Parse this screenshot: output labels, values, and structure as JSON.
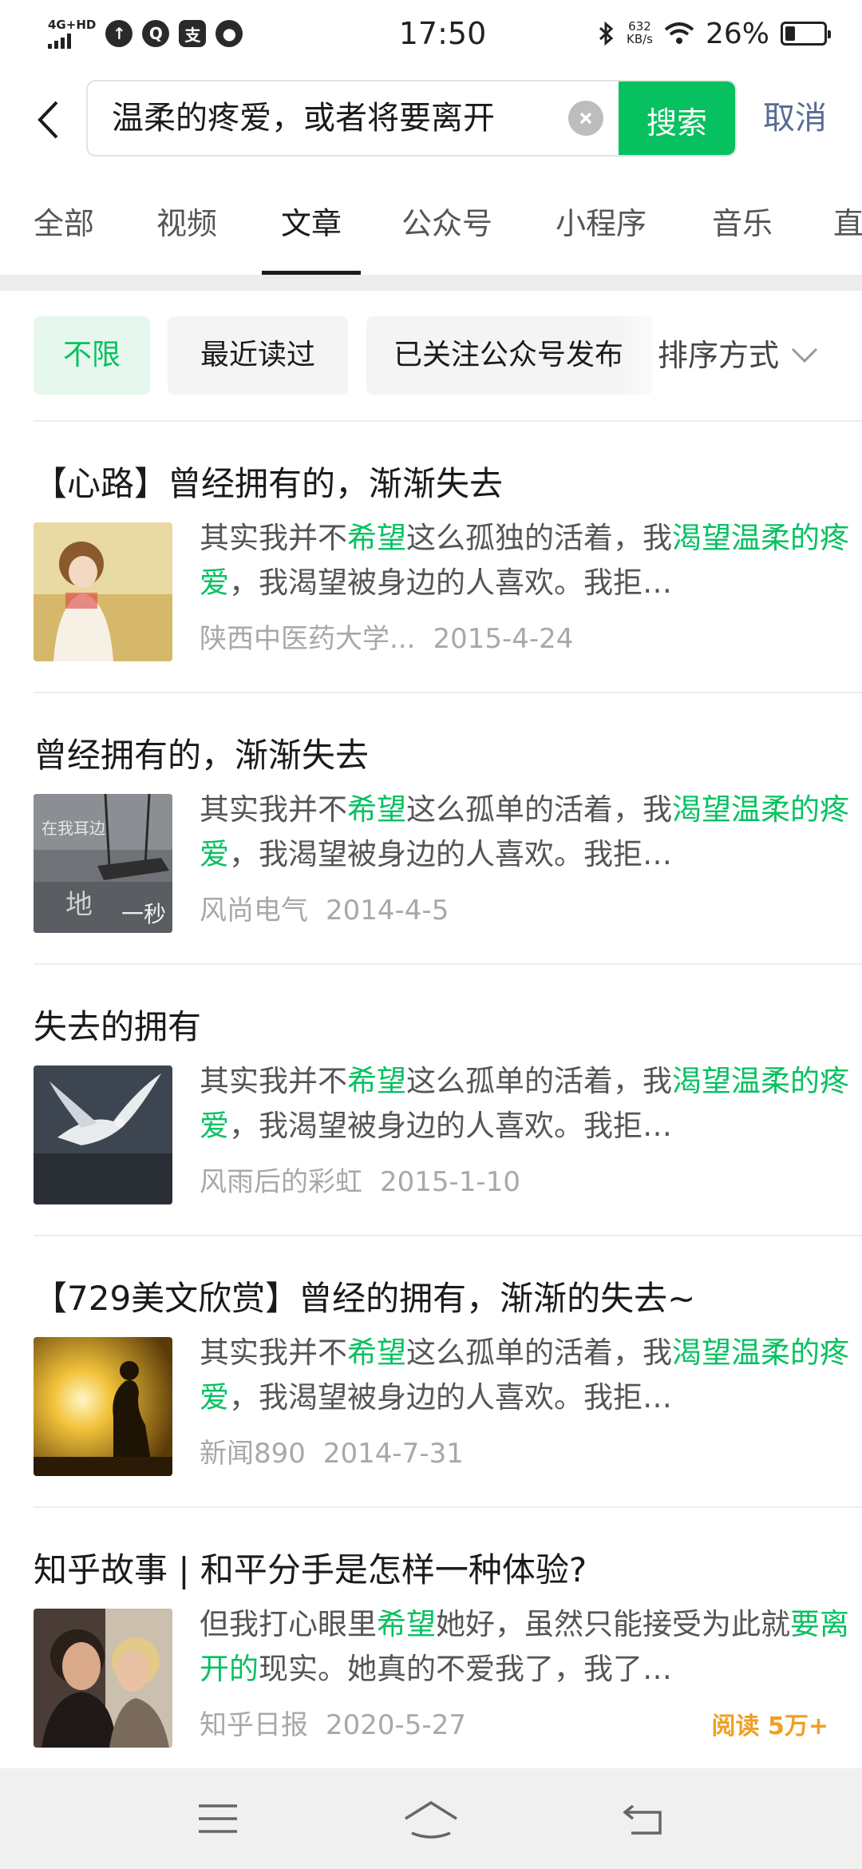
{
  "status_bar": {
    "network": "4G+HD",
    "apps": [
      "↑",
      "Q",
      "支",
      "●"
    ],
    "time": "17:50",
    "speed_value": "632",
    "speed_unit": "KB/s",
    "battery": "26%",
    "battery_level": 0.26
  },
  "search": {
    "query": "温柔的疼爱，或者将要离开",
    "search_label": "搜索",
    "cancel_label": "取消"
  },
  "tabs": [
    {
      "label": "全部",
      "active": false
    },
    {
      "label": "视频",
      "active": false
    },
    {
      "label": "文章",
      "active": true
    },
    {
      "label": "公众号",
      "active": false
    },
    {
      "label": "小程序",
      "active": false
    },
    {
      "label": "音乐",
      "active": false
    },
    {
      "label": "直",
      "active": false
    }
  ],
  "filters": {
    "chips": [
      {
        "label": "不限",
        "active": true
      },
      {
        "label": "最近读过",
        "active": false
      },
      {
        "label": "已关注公众号发布",
        "active": false
      }
    ],
    "sort_label": "排序方式"
  },
  "results": [
    {
      "title": "【心路】曾经拥有的，渐渐失去",
      "snippet": [
        {
          "t": "其实我并不",
          "hl": false
        },
        {
          "t": "希望",
          "hl": true
        },
        {
          "t": "这么孤独的活着，我",
          "hl": false
        },
        {
          "t": "渴望温柔的疼爱",
          "hl": true
        },
        {
          "t": "，我渴望被身边的人喜欢。我拒…",
          "hl": false
        }
      ],
      "source": "陕西中医药大学...",
      "date": "2015-4-24",
      "reads": ""
    },
    {
      "title": "曾经拥有的，渐渐失去",
      "snippet": [
        {
          "t": "其实我并不",
          "hl": false
        },
        {
          "t": "希望",
          "hl": true
        },
        {
          "t": "这么孤单的活着，我",
          "hl": false
        },
        {
          "t": "渴望温柔的疼爱",
          "hl": true
        },
        {
          "t": "，我渴望被身边的人喜欢。我拒…",
          "hl": false
        }
      ],
      "source": "风尚电气",
      "date": "2014-4-5",
      "reads": ""
    },
    {
      "title": "失去的拥有",
      "snippet": [
        {
          "t": "其实我并不",
          "hl": false
        },
        {
          "t": "希望",
          "hl": true
        },
        {
          "t": "这么孤单的活着，我",
          "hl": false
        },
        {
          "t": "渴望温柔的疼爱",
          "hl": true
        },
        {
          "t": "，我渴望被身边的人喜欢。我拒…",
          "hl": false
        }
      ],
      "source": "风雨后的彩虹",
      "date": "2015-1-10",
      "reads": ""
    },
    {
      "title": "【729美文欣赏】曾经的拥有，渐渐的失去~",
      "snippet": [
        {
          "t": "其实我并不",
          "hl": false
        },
        {
          "t": "希望",
          "hl": true
        },
        {
          "t": "这么孤单的活着，我",
          "hl": false
        },
        {
          "t": "渴望温柔的疼爱",
          "hl": true
        },
        {
          "t": "，我渴望被身边的人喜欢。我拒…",
          "hl": false
        }
      ],
      "source": "新闻890",
      "date": "2014-7-31",
      "reads": ""
    },
    {
      "title": "知乎故事 | 和平分手是怎样一种体验?",
      "snippet": [
        {
          "t": "但我打心眼里",
          "hl": false
        },
        {
          "t": "希望",
          "hl": true
        },
        {
          "t": "她好，虽然只能接受为此就",
          "hl": false
        },
        {
          "t": "要离开的",
          "hl": true
        },
        {
          "t": "现实。她真的不爱我了，我了…",
          "hl": false
        }
      ],
      "source": "知乎日报",
      "date": "2020-5-27",
      "reads": "阅读 5万+"
    }
  ],
  "colors": {
    "accent": "#07c160",
    "link": "#576b95",
    "reads": "#f0a020"
  },
  "icons": {
    "back": "back-arrow-icon",
    "clear": "clear-icon",
    "sort": "chevron-down-icon",
    "nav": [
      "menu-icon",
      "home-icon",
      "back-icon"
    ]
  }
}
